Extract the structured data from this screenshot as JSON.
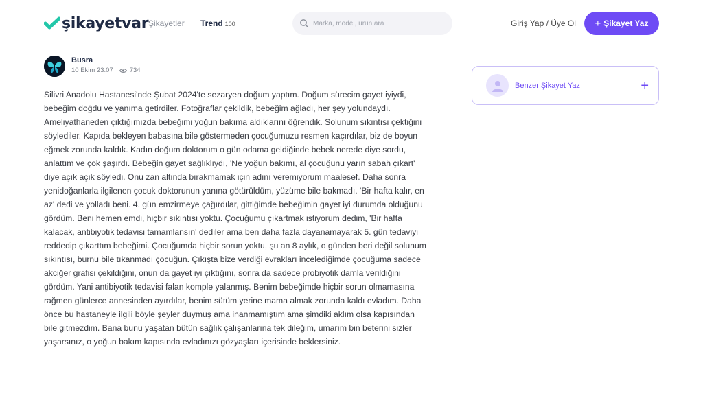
{
  "header": {
    "logo_text": "şikayetvar",
    "nav": {
      "complaints": "Şikayetler",
      "trend": "Trend",
      "trend_badge": "100"
    },
    "search_placeholder": "Marka, model, ürün ara",
    "auth": "Giriş Yap / Üye Ol",
    "cta": "Şikayet Yaz",
    "brand_color": "#6e4bf5"
  },
  "complaint": {
    "author": "Busra",
    "date": "10 Ekim 23:07",
    "views": "734",
    "text": "Silivri Anadolu Hastanesi'nde Şubat 2024'te sezaryen doğum yaptım. Doğum sürecim gayet iyiydi, bebeğim doğdu ve yanıma getirdiler. Fotoğraflar çekildik, bebeğim ağladı, her şey yolundaydı. Ameliyathaneden çıktığımızda bebeğimi yoğun bakıma aldıklarını öğrendik. Solunum sıkıntısı çektiğini söylediler. Kapıda bekleyen babasına bile göstermeden çocuğumuzu resmen kaçırdılar, biz de boyun eğmek zorunda kaldık. Kadın doğum doktorum o gün odama geldiğinde bebek nerede diye sordu, anlattım ve çok şaşırdı. Bebeğin gayet sağlıklıydı, 'Ne yoğun bakımı, al çocuğunu yarın sabah çıkart' diye açık açık söyledi. Onu zan altında bırakmamak için adını veremiyorum maalesef. Daha sonra yenidoğanlarla ilgilenen çocuk doktorunun yanına götürüldüm, yüzüme bile bakmadı. 'Bir hafta kalır, en az' dedi ve yolladı beni. 4. gün emzirmeye çağırdılar, gittiğimde bebeğimin gayet iyi durumda olduğunu gördüm. Beni hemen emdi, hiçbir sıkıntısı yoktu. Çocuğumu çıkartmak istiyorum dedim, 'Bir hafta kalacak, antibiyotik tedavisi tamamlansın' dediler ama ben daha fazla dayanamayarak 5. gün tedaviyi reddedip çıkarttım bebeğimi. Çocuğumda hiçbir sorun yoktu, şu an 8 aylık, o günden beri değil solunum sıkıntısı, burnu bile tıkanmadı çocuğun. Çıkışta bize verdiği evrakları incelediğimde çocuğuma sadece akciğer grafisi çekildiğini, onun da gayet iyi çıktığını, sonra da sadece probiyotik damla verildiğini gördüm. Yani antibiyotik tedavisi falan komple yalanmış. Benim bebeğimde hiçbir sorun olmamasına rağmen günlerce annesinden ayırdılar, benim sütüm yerine mama almak zorunda kaldı evladım. Daha önce bu hastaneyle ilgili böyle şeyler duymuş ama inanmamıştım ama şimdiki aklım olsa kapısından bile gitmezdim. Bana bunu yaşatan bütün sağlık çalışanlarına tek dileğim, umarım bin beterini sizler yaşarsınız, o yoğun bakım kapısında evladınızı gözyaşları içerisinde beklersiniz."
  },
  "sidebar": {
    "similar_label": "Benzer Şikayet Yaz"
  }
}
